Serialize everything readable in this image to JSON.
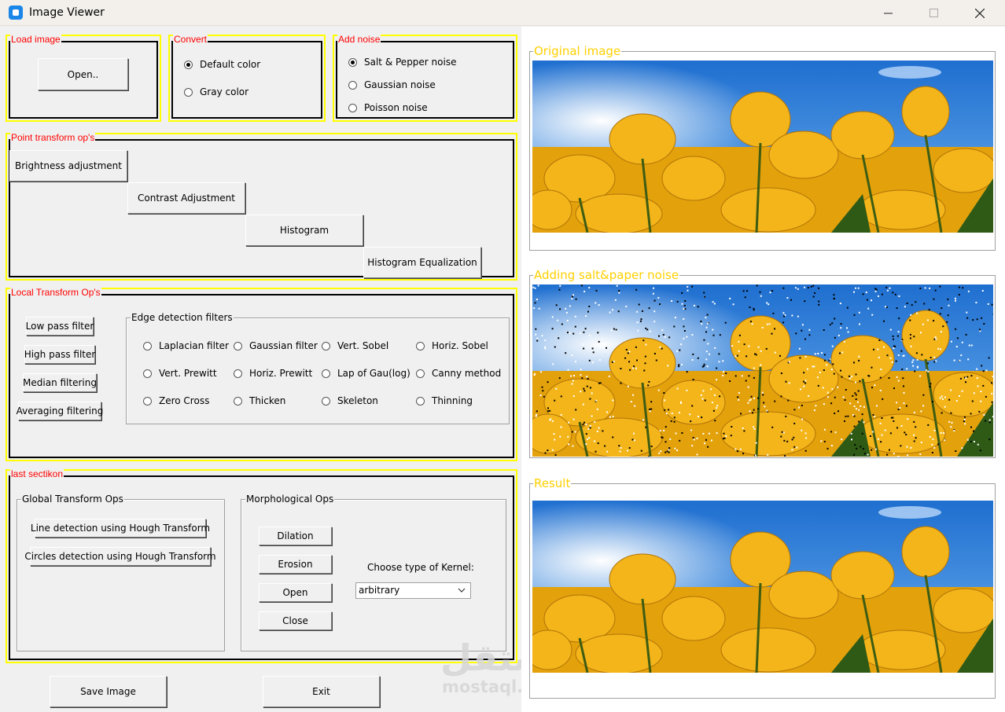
{
  "window": {
    "title": "Image Viewer",
    "controls": [
      "minimize-icon",
      "maximize-icon",
      "close-icon"
    ]
  },
  "load_image": {
    "legend": "Load image",
    "open_label": "Open.."
  },
  "convert": {
    "legend": "Convert",
    "options": [
      "Default color",
      "Gray color"
    ],
    "selected": "Default color"
  },
  "add_noise": {
    "legend": "Add noise",
    "options": [
      "Salt & Pepper noise",
      "Gaussian noise",
      "Poisson noise"
    ],
    "selected": "Salt & Pepper noise"
  },
  "point_ops": {
    "legend": "Point transform op's",
    "buttons": [
      "Brightness adjustment",
      "Contrast Adjustment",
      "Histogram",
      "Histogram Equalization"
    ]
  },
  "local_ops": {
    "legend": "Local Transform Op's",
    "buttons": [
      "Low pass filter",
      "High pass filter",
      "Median filtering",
      "Averaging filtering"
    ],
    "edge": {
      "legend": "Edge detection filters",
      "options": [
        "Laplacian filter",
        "Gaussian filter",
        "Vert. Sobel",
        "Horiz. Sobel",
        "Vert. Prewitt",
        "Horiz. Prewitt",
        "Lap of Gau(log)",
        "Canny method",
        "Zero Cross",
        "Thicken",
        "Skeleton",
        "Thinning"
      ]
    }
  },
  "last_section": {
    "legend": "last sectikon",
    "global": {
      "legend": "Global Transform Ops",
      "buttons": [
        "Line detection using Hough Transform",
        "Circles detection using Hough Transform"
      ]
    },
    "morph": {
      "legend": "Morphological Ops",
      "buttons": [
        "Dilation",
        "Erosion",
        "Open",
        "Close"
      ],
      "kernel_label": "Choose type of Kernel:",
      "kernel_value": "arbitrary"
    }
  },
  "footer": {
    "save_label": "Save Image",
    "exit_label": "Exit"
  },
  "images": {
    "original_title": "Original image",
    "noisy_title": "Adding salt&paper noise",
    "result_title": "Result"
  },
  "watermark": {
    "arabic": "مستقل",
    "latin": "mostaql.com"
  },
  "colors": {
    "frame_yellow": "#ffff00",
    "legend_red": "#ff0000",
    "image_title": "#ffd000"
  }
}
